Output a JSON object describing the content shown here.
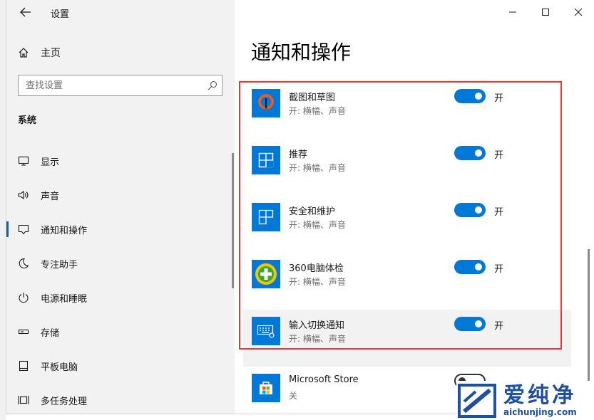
{
  "window": {
    "title": "设置",
    "controls": {
      "minimize": "minimize",
      "maximize": "maximize",
      "close": "close"
    }
  },
  "sidebar": {
    "home_label": "主页",
    "search_placeholder": "查找设置",
    "section_label": "系统",
    "items": [
      {
        "label": "显示",
        "icon": "monitor-icon",
        "active": false
      },
      {
        "label": "声音",
        "icon": "speaker-icon",
        "active": false
      },
      {
        "label": "通知和操作",
        "icon": "notification-icon",
        "active": true
      },
      {
        "label": "专注助手",
        "icon": "moon-icon",
        "active": false
      },
      {
        "label": "电源和睡眠",
        "icon": "power-icon",
        "active": false
      },
      {
        "label": "存储",
        "icon": "storage-icon",
        "active": false
      },
      {
        "label": "平板电脑",
        "icon": "tablet-icon",
        "active": false
      },
      {
        "label": "多任务处理",
        "icon": "multitask-icon",
        "active": false
      }
    ]
  },
  "main": {
    "page_title": "通知和操作",
    "apps": [
      {
        "name": "截图和草图",
        "sub": "开: 横幅、声音",
        "state": "开",
        "on": true,
        "icon": "snip-sketch-icon"
      },
      {
        "name": "推荐",
        "sub": "开: 横幅、声音",
        "state": "开",
        "on": true,
        "icon": "tile-app-icon"
      },
      {
        "name": "安全和维护",
        "sub": "开: 横幅、声音",
        "state": "开",
        "on": true,
        "icon": "tile-app-icon"
      },
      {
        "name": "360电脑体检",
        "sub": "开: 横幅、声音",
        "state": "开",
        "on": true,
        "icon": "360-icon"
      },
      {
        "name": "输入切换通知",
        "sub": "开: 横幅、声音",
        "state": "开",
        "on": true,
        "icon": "keyboard-icon"
      },
      {
        "name": "Microsoft Store",
        "sub": "关",
        "state": "",
        "on": false,
        "icon": "store-icon"
      }
    ]
  },
  "watermark": {
    "text_cn": "爱纯净",
    "url": "aichunjing.com"
  },
  "colors": {
    "accent": "#0078d7",
    "highlight_box": "#e53935",
    "watermark": "#1f4fa0"
  }
}
